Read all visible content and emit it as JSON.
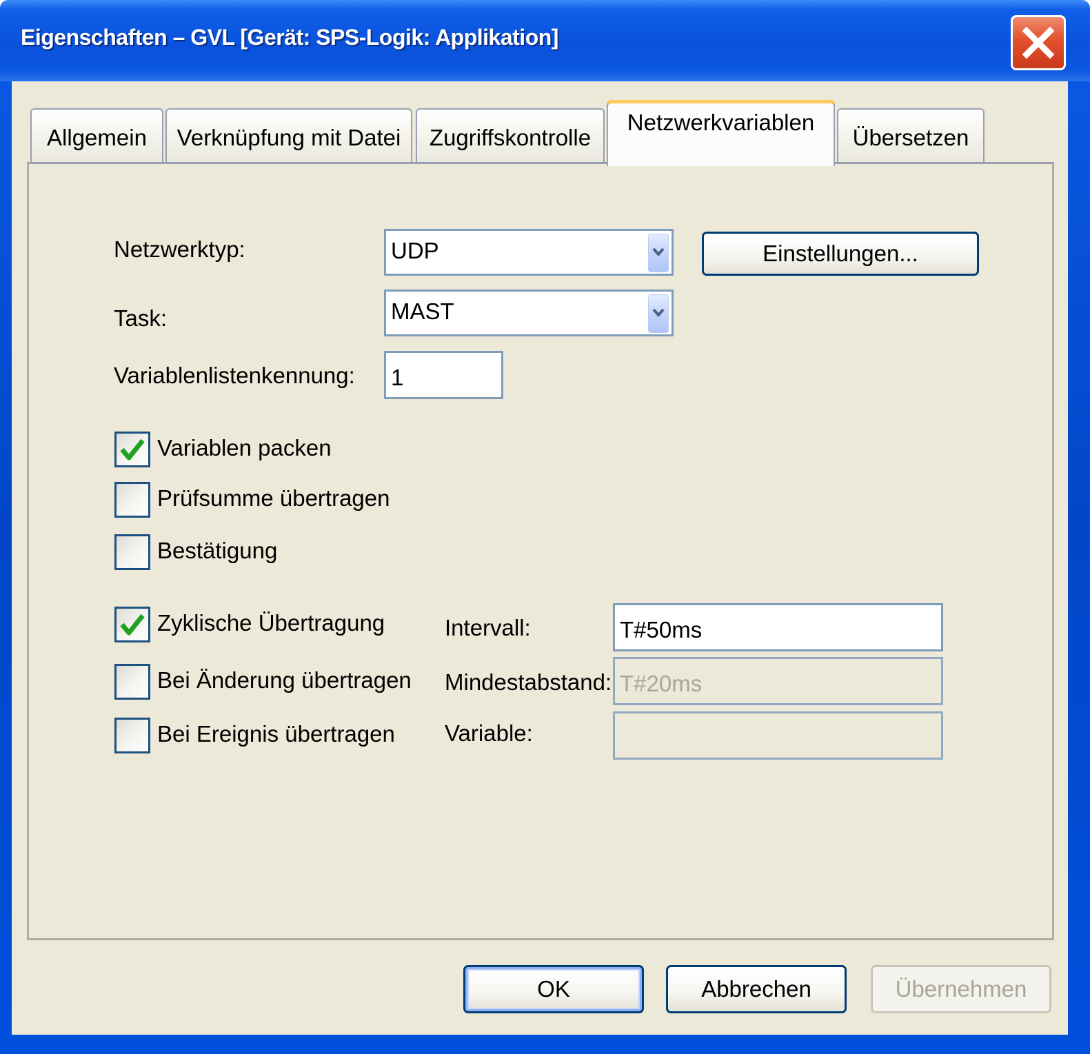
{
  "window": {
    "title": "Eigenschaften – GVL [Gerät: SPS-Logik: Applikation]"
  },
  "tabs": [
    {
      "label": "Allgemein",
      "active": false
    },
    {
      "label": "Verknüpfung mit Datei",
      "active": false
    },
    {
      "label": "Zugriffskontrolle",
      "active": false
    },
    {
      "label": "Netzwerkvariablen",
      "active": true
    },
    {
      "label": "Übersetzen",
      "active": false
    }
  ],
  "form": {
    "netzwerktyp": {
      "label": "Netzwerktyp:",
      "value": "UDP"
    },
    "settings_button": "Einstellungen...",
    "task": {
      "label": "Task:",
      "value": "MAST"
    },
    "listenkennung": {
      "label": "Variablenlistenkennung:",
      "value": "1"
    },
    "checkboxes": {
      "variablen_packen": {
        "label": "Variablen packen",
        "checked": true
      },
      "pruefsumme": {
        "label": "Prüfsumme übertragen",
        "checked": false
      },
      "bestaetigung": {
        "label": "Bestätigung",
        "checked": false
      },
      "zyklisch": {
        "label": "Zyklische Übertragung",
        "checked": true
      },
      "bei_aenderung": {
        "label": "Bei Änderung übertragen",
        "checked": false
      },
      "bei_ereignis": {
        "label": "Bei Ereignis übertragen",
        "checked": false
      }
    },
    "intervall": {
      "label": "Intervall:",
      "value": "T#50ms"
    },
    "mindestabstand": {
      "label": "Mindestabstand:",
      "value": "T#20ms"
    },
    "variable": {
      "label": "Variable:",
      "value": ""
    }
  },
  "buttons": {
    "ok": "OK",
    "cancel": "Abbrechen",
    "apply": "Übernehmen"
  },
  "colors": {
    "titlebar": "#0a52dc",
    "dialog_bg": "#ece9d8",
    "active_tab_accent": "#f8a937",
    "check_green": "#21a121",
    "close_red": "#e2502c"
  },
  "icons": {
    "close": "close-x-icon",
    "dropdown": "chevron-down-icon",
    "check": "checkmark-icon"
  }
}
